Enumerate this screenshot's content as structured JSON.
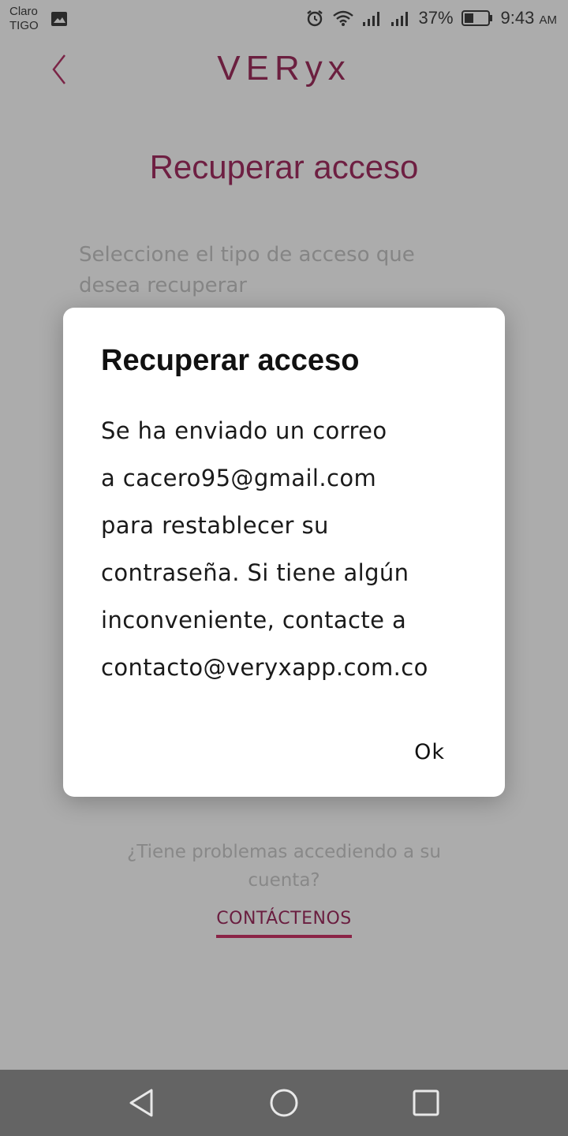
{
  "status_bar": {
    "carrier_line1": "Claro",
    "carrier_line2": "TIGO",
    "battery_percent": "37%",
    "time": "9:43",
    "time_suffix": "AM"
  },
  "header": {
    "app_name": "VERyx"
  },
  "page": {
    "title": "Recuperar acceso",
    "instruction": "Seleccione el tipo de acceso que desea recuperar",
    "help_line1": "¿Tiene problemas accediendo a su",
    "help_line2": "cuenta?",
    "contact_label": "CONTÁCTENOS"
  },
  "dialog": {
    "title": "Recuperar acceso",
    "body_lines": [
      "Se ha enviado un correo",
      "a cacero95@gmail.com",
      "para restablecer su",
      "contraseña. Si tiene algún",
      "inconveniente, contacte a",
      "contacto@veryxapp.com.co"
    ],
    "ok_label": "Ok"
  },
  "colors": {
    "brand": "#6e1f42",
    "scrim": "#acacac",
    "nav_bar": "#646464"
  }
}
